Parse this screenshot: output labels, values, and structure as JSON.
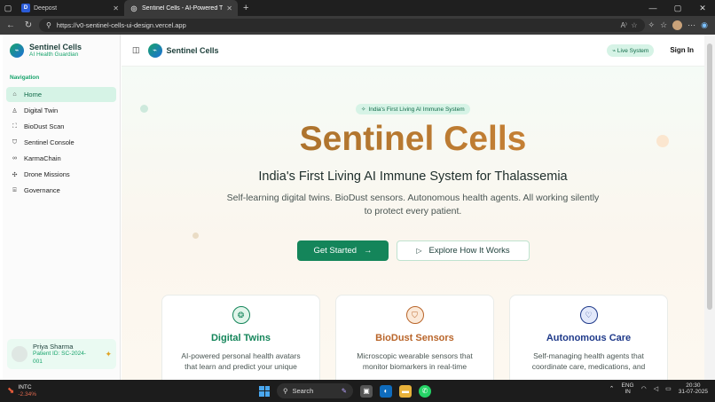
{
  "browser": {
    "tabs": [
      {
        "title": "Deepost",
        "favicon": "D",
        "active": false
      },
      {
        "title": "Sentinel Cells - AI-Powered Thala...",
        "favicon": "globe-icon",
        "active": true
      }
    ],
    "url": "https://v0-sentinel-cells-ui-design.vercel.app"
  },
  "sidebar": {
    "brand_name": "Sentinel Cells",
    "brand_tagline": "AI Health Guardian",
    "nav_label": "Navigation",
    "items": [
      {
        "label": "Home",
        "icon": "home-icon",
        "active": true
      },
      {
        "label": "Digital Twin",
        "icon": "user-icon",
        "active": false
      },
      {
        "label": "BioDust Scan",
        "icon": "scan-icon",
        "active": false
      },
      {
        "label": "Sentinel Console",
        "icon": "shield-icon",
        "active": false
      },
      {
        "label": "KarmaChain",
        "icon": "link-icon",
        "active": false
      },
      {
        "label": "Drone Missions",
        "icon": "drone-icon",
        "active": false
      },
      {
        "label": "Governance",
        "icon": "building-icon",
        "active": false
      }
    ],
    "user": {
      "name": "Priya Sharma",
      "id": "Patient ID: SC-2024-001"
    }
  },
  "header": {
    "title": "Sentinel Cells",
    "status": "Live System",
    "signin": "Sign In"
  },
  "hero": {
    "pill": "India's First Living AI Immune System",
    "title": "Sentinel Cells",
    "subtitle": "India's First Living AI Immune System for Thalassemia",
    "description": "Self-learning digital twins. BioDust sensors. Autonomous health agents. All working silently to protect every patient.",
    "primary_cta": "Get Started",
    "secondary_cta": "Explore How It Works"
  },
  "features": [
    {
      "title": "Digital Twins",
      "desc": "AI-powered personal health avatars that learn and predict your unique",
      "icon": "brain-icon",
      "color": "#14855a"
    },
    {
      "title": "BioDust Sensors",
      "desc": "Microscopic wearable sensors that monitor biomarkers in real-time",
      "icon": "shield-icon",
      "color": "#b9652a"
    },
    {
      "title": "Autonomous Care",
      "desc": "Self-managing health agents that coordinate care, medications, and",
      "icon": "heart-icon",
      "color": "#1f3a8a"
    }
  ],
  "taskbar": {
    "stock_symbol": "INTC",
    "stock_change": "-2.34%",
    "search": "Search",
    "lang": "ENG",
    "region": "IN",
    "time": "20:30",
    "date": "31-07-2025"
  }
}
